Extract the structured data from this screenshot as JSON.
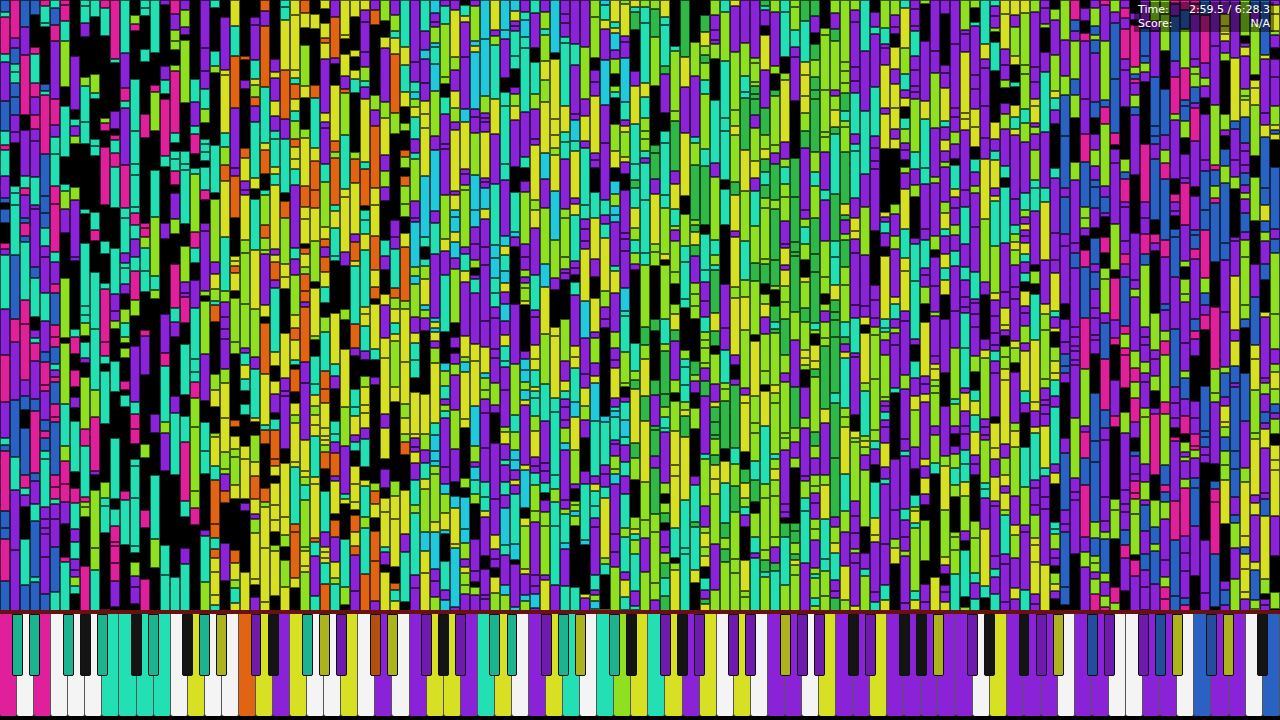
{
  "hud": {
    "time_label": "Time:",
    "time_value": "2:59.5 / 6:28.3",
    "score_label": "Score:",
    "score_value": "N/A"
  },
  "palette": [
    "#e0209a",
    "#22e0b4",
    "#8ee020",
    "#8a22d8",
    "#d8e024",
    "#e06412",
    "#2a62c4",
    "#2fb848",
    "#22c8dc"
  ],
  "note_field": {
    "regions": [
      {
        "from": 0,
        "to": 5,
        "colors": [
          6,
          1,
          3,
          0
        ],
        "density": 0.9
      },
      {
        "from": 6,
        "to": 20,
        "colors": [
          1,
          0,
          1,
          3,
          2
        ],
        "density": 0.6
      },
      {
        "from": 21,
        "to": 40,
        "colors": [
          2,
          4,
          3,
          1,
          5,
          4
        ],
        "density": 0.8
      },
      {
        "from": 41,
        "to": 62,
        "colors": [
          2,
          4,
          3,
          1,
          3,
          8
        ],
        "density": 0.9
      },
      {
        "from": 63,
        "to": 84,
        "colors": [
          2,
          1,
          3,
          4,
          7,
          2
        ],
        "density": 0.92
      },
      {
        "from": 85,
        "to": 105,
        "colors": [
          3,
          2,
          4,
          1,
          3
        ],
        "density": 0.9
      },
      {
        "from": 106,
        "to": 121,
        "colors": [
          3,
          2,
          6,
          3,
          0
        ],
        "density": 0.85
      },
      {
        "from": 122,
        "to": 127,
        "colors": [
          4,
          6,
          2,
          3
        ],
        "density": 0.9
      }
    ]
  },
  "keys": [
    0,
    1,
    -1,
    1,
    0,
    -1,
    1,
    -1,
    -1,
    -1,
    1,
    1,
    1,
    -1,
    1,
    1,
    1,
    -1,
    -1,
    4,
    1,
    -1,
    4,
    -1,
    5,
    3,
    4,
    -1,
    3,
    4,
    1,
    -1,
    4,
    -1,
    3,
    4,
    -1,
    5,
    3,
    4,
    -1,
    3,
    3,
    4,
    -1,
    4,
    3,
    3,
    1,
    1,
    4,
    1,
    -1,
    3,
    3,
    4,
    1,
    1,
    4,
    -1,
    1,
    1,
    2,
    -1,
    4,
    1,
    3,
    4,
    -1,
    3,
    3,
    4,
    -1,
    3,
    4,
    3,
    -1,
    3,
    4,
    3,
    3,
    -1,
    3,
    4,
    3,
    -1,
    3,
    3,
    4,
    3,
    -1,
    3,
    -1,
    3,
    4,
    3,
    3,
    3,
    -1,
    -1,
    4,
    3,
    -1,
    3,
    3,
    3,
    4,
    -1,
    3,
    6,
    3,
    3,
    -1,
    -1,
    3,
    3,
    6,
    3,
    4,
    -1,
    6,
    6,
    3,
    4,
    3,
    -1,
    -1,
    6
  ]
}
